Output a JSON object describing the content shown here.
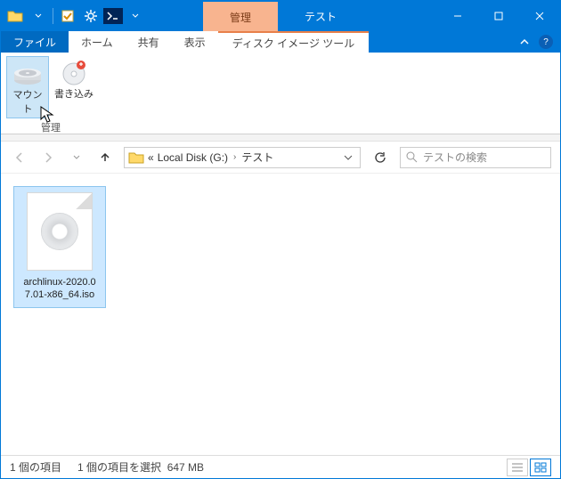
{
  "titlebar": {
    "context_tab_manage": "管理",
    "context_tab_test": "テスト"
  },
  "tabs": {
    "file": "ファイル",
    "home": "ホーム",
    "share": "共有",
    "view": "表示",
    "disc_tools": "ディスク イメージ ツール"
  },
  "ribbon": {
    "mount": "マウント",
    "burn": "書き込み",
    "group": "管理"
  },
  "breadcrumb": {
    "prefix": "«",
    "seg1": "Local Disk (G:)",
    "seg2": "テスト"
  },
  "search": {
    "placeholder": "テストの検索"
  },
  "file": {
    "name": "archlinux-2020.07.01-x86_64.iso"
  },
  "status": {
    "count": "1 個の項目",
    "selection": "1 個の項目を選択",
    "size": "647 MB"
  }
}
